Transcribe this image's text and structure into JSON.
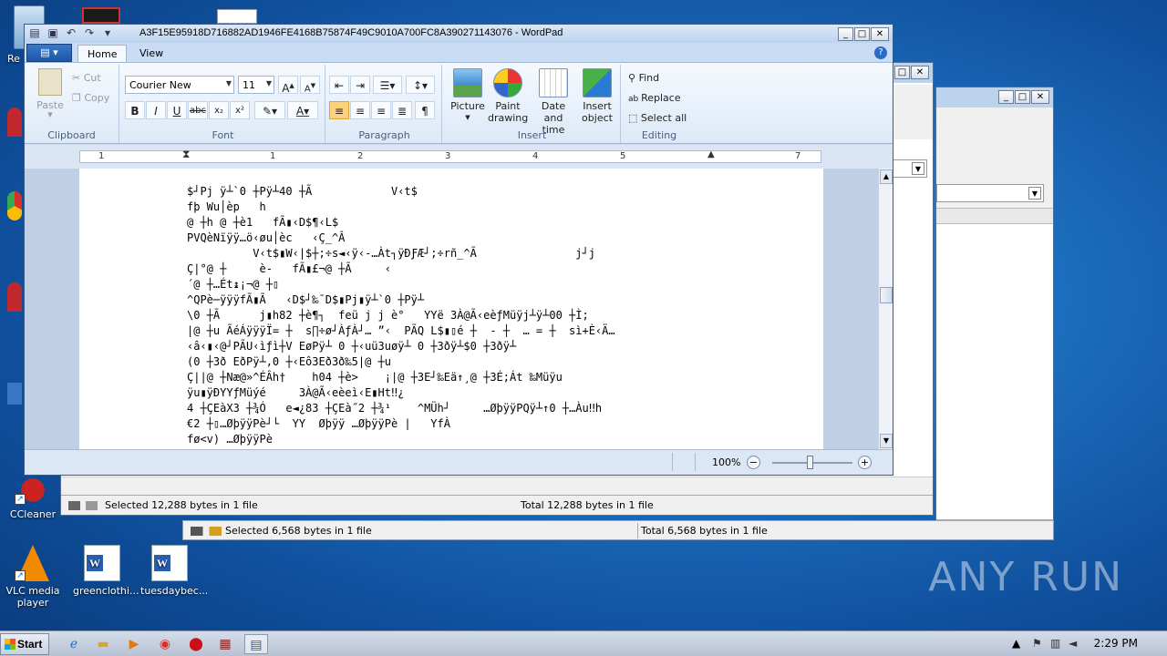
{
  "desktop": {
    "icons": [
      {
        "label": "VLC media player"
      },
      {
        "label": "greenclothi..."
      },
      {
        "label": "tuesdaybec..."
      },
      {
        "label": "CCleaner"
      }
    ],
    "edge_label_re": "Re",
    "watermark": "ANY RUN"
  },
  "back_window_2": {
    "status_left": "Selected 6,568 bytes in 1 file",
    "status_right": "Total 6,568 bytes in 1 file"
  },
  "back_window_1": {
    "status_left": "Selected 12,288 bytes in 1 file",
    "status_right": "Total 12,288 bytes in 1 file"
  },
  "wordpad": {
    "title": "A3F15E95918D716882AD1946FE4168B75874F49C9010A700FC8A390271143076 - WordPad",
    "tabs": [
      "Home",
      "View"
    ],
    "clipboard": {
      "paste": "Paste",
      "cut": "Cut",
      "copy": "Copy",
      "label": "Clipboard"
    },
    "font": {
      "family": "Courier New",
      "size": "11",
      "label": "Font"
    },
    "paragraph": {
      "label": "Paragraph"
    },
    "insert": {
      "picture": "Picture",
      "paint1": "Paint",
      "paint2": "drawing",
      "date1": "Date and",
      "date2": "time",
      "obj1": "Insert",
      "obj2": "object",
      "label": "Insert"
    },
    "editing": {
      "find": "Find",
      "replace": "Replace",
      "select_all": "Select all",
      "label": "Editing"
    },
    "ruler_numbers": [
      "1",
      "1",
      "2",
      "3",
      "4",
      "5",
      "6",
      "7"
    ],
    "document_lines": [
      "$┘Pj ÿ┴`0 ┼Pÿ┴40 ┼Ã            V‹t$",
      "fþ Wu│èp   h",
      "@ ┼h @ ┼è1   fÃ▮‹D$¶‹L$",
      "PVQèNïÿÿ…ö‹øu│èc   ‹Ç_^Â",
      "          V‹t$▮W‹|$┼;÷s◄‹ÿ‹-…Àt┐ÿÐƑÆ┘;÷rñ_^Ã               j┘j",
      "Ç|°@ ┼     è-   fÃ▮£¬@ ┼Ã     ‹",
      "´@ ┼…Ét↨¡¬@ ┼▯",
      "^QPè─ÿÿÿfÃ▮Ã   ‹D$┘‰¯D$▮Pj▮ÿ┴`0 ┼Pÿ┴",
      "\\0 ┼Ã      j▮h82 ┼è¶┐  feü j j è°   YYë 3À@Ã‹eèƒMüÿj┴ÿ┴00 ┼Ì;",
      "|@ ┼u ÃéÁÿÿÿÏ= ┼  s∏÷ø┘ÀƒÀ┘… ”‹  PÃQ L$▮▯é ┼  - ┼  … = ┼  sì+È‹Ä…",
      "‹â‹▮‹@┘PÃU‹ìƒì┼V EøPÿ┴ 0 ┼‹uü3uøÿ┴ 0 ┼3ðÿ┴$0 ┼3ðÿ┴",
      "(0 ┼3ð EðPÿ┴,0 ┼‹Eô3Eð3ð‰5|@ ┼u",
      "Ç||@ ┼Næ@»^ÉÂh†    h04 ┼è>    ¡|@ ┼3E┘‰Eä↑¸@ ┼3É;Át ‰Müÿu",
      "ÿu▮ÿÐYYƒMüýé     3À@Ã‹eèeì‹E▮Ht‼¿",
      "4 ┼ÇEàX3 ┼¾Ó   e◄¿83 ┼ÇEà˝2 ┼¾¹    ^MÜh┘     …ØþÿÿPQÿ┴↑0 ┼…Àu‼h",
      "€2 ┼▯…ØþÿÿPè┘└  YY  Øþÿÿ …ØþÿÿPè |   YfÀ",
      "fø<v) …ØþÿÿPè"
    ],
    "zoom": "100%",
    "zoom_level_percent": 100
  },
  "taskbar": {
    "start": "Start",
    "clock": "2:29 PM"
  }
}
